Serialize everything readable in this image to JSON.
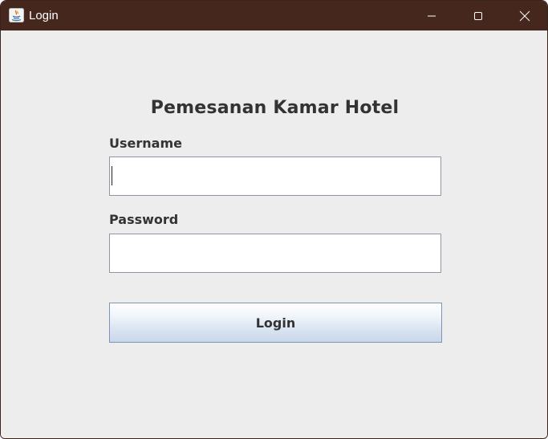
{
  "window": {
    "title": "Login"
  },
  "form": {
    "heading": "Pemesanan Kamar Hotel",
    "username_label": "Username",
    "username_value": "",
    "password_label": "Password",
    "password_value": "",
    "login_button": "Login"
  },
  "icons": {
    "app": "java-icon",
    "minimize": "minimize-icon",
    "maximize": "maximize-icon",
    "close": "close-icon"
  },
  "colors": {
    "titlebar": "#46271d",
    "background": "#eeeded",
    "text": "#333333",
    "button_gradient_bottom": "#c8d7ec"
  }
}
